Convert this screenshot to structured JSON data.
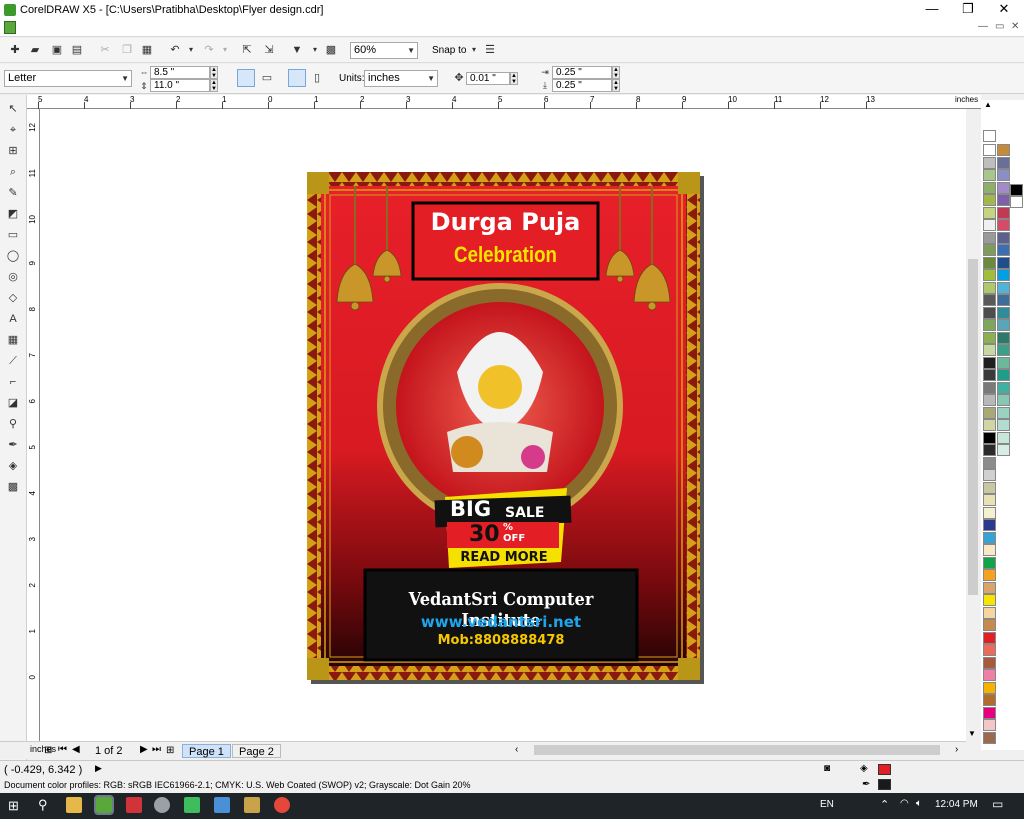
{
  "window": {
    "title": "CorelDRAW X5 - [C:\\Users\\Pratibha\\Desktop\\Flyer design.cdr]",
    "minimize": "—",
    "maximize": "❐",
    "close": "✕"
  },
  "toolbar": {
    "zoom_value": "60%",
    "snap_label": "Snap to",
    "paper_size": "Letter",
    "width_value": "8.5 \"",
    "height_value": "11.0 \"",
    "units_label": "Units:",
    "units_value": "inches",
    "nudge_value": "0.01 \"",
    "dup_x_value": "0.25 \"",
    "dup_y_value": "0.25 \""
  },
  "ruler": {
    "unit_label": "inches",
    "h_ticks": [
      "5",
      "4",
      "3",
      "2",
      "1",
      "0",
      "1",
      "2",
      "3",
      "4",
      "5",
      "6",
      "7",
      "8",
      "9",
      "10",
      "11",
      "12",
      "13"
    ],
    "v_ticks": [
      "12",
      "11",
      "10",
      "9",
      "8",
      "7",
      "6",
      "5",
      "4",
      "3",
      "2",
      "1",
      "0"
    ]
  },
  "flyer": {
    "title": "Durga Puja",
    "subtitle": "Celebration",
    "sale_big": "BIG",
    "sale_word": "SALE",
    "sale_pct": "30",
    "sale_pct_sign": "%",
    "sale_off": "OFF",
    "read_more": "READ MORE",
    "institute": "VedantSri Computer Institute",
    "website": "www.vedantsri.net",
    "mobile": "Mob:8808888478"
  },
  "pagenav": {
    "page_count": "1 of 2",
    "tabs": [
      "Page 1",
      "Page 2"
    ]
  },
  "status": {
    "coords": "( -0.429, 6.342 )",
    "color_profiles": "Document color profiles: RGB: sRGB IEC61966-2.1; CMYK: U.S. Web Coated (SWOP) v2; Grayscale: Dot Gain 20%",
    "fill_color": "#e31e24",
    "outline_color": "#1a1a1a"
  },
  "taskbar": {
    "lang": "EN",
    "time": "12:04 PM"
  },
  "palette": {
    "colors": [
      "#ffffff",
      "#bebebe",
      "#a7c58d",
      "#8fb167",
      "#a2b84e",
      "#c6d47f",
      "#f0f0f0",
      "#9a9a9a",
      "#7f9c5a",
      "#6a8b3e",
      "#9fbf3b",
      "#b0c86b",
      "#5a5a5a",
      "#4d4d4d",
      "#7fa75b",
      "#8db04f",
      "#c7d8a0",
      "#1f1f1f",
      "#3a3a3a",
      "#7a7a7a",
      "#b8b8b8",
      "#aaa877",
      "#d1d5a3",
      "#000000",
      "#2b2b2b",
      "#8c8c8c",
      "#d0d0d0",
      "#c9c7a0",
      "#e8e1b8",
      "#f5f0d0",
      "#2a3b8f",
      "#35a2d8",
      "#f7e8c8",
      "#11a54a",
      "#f5a21f",
      "#d8a56d",
      "#f6e500",
      "#f5d6a0",
      "#c78a4e",
      "#e31e24",
      "#ec6a5a",
      "#a85b3a",
      "#f07fa6",
      "#f7b200",
      "#b36c2b",
      "#e6007e",
      "#f4c7c7",
      "#9b6b4e",
      "#c48b3b",
      "#6a6f9a",
      "#8a8fc4",
      "#a48ac8",
      "#7e5fa8",
      "#c03a56",
      "#d64a6a",
      "#5d5f8e",
      "#3a6fb3",
      "#1e4f8c",
      "#00a0e3",
      "#4fb4d8",
      "#3d6e9a",
      "#2f8c9a",
      "#5aa5b8",
      "#2b7a6a",
      "#3aa08a",
      "#6bb89a",
      "#1f9c8a",
      "#40b0a0",
      "#85c9b5",
      "#9ad1c0",
      "#b2dccf",
      "#c8e6da",
      "#d6eee4"
    ],
    "black": "#000000",
    "white": "#ffffff"
  }
}
